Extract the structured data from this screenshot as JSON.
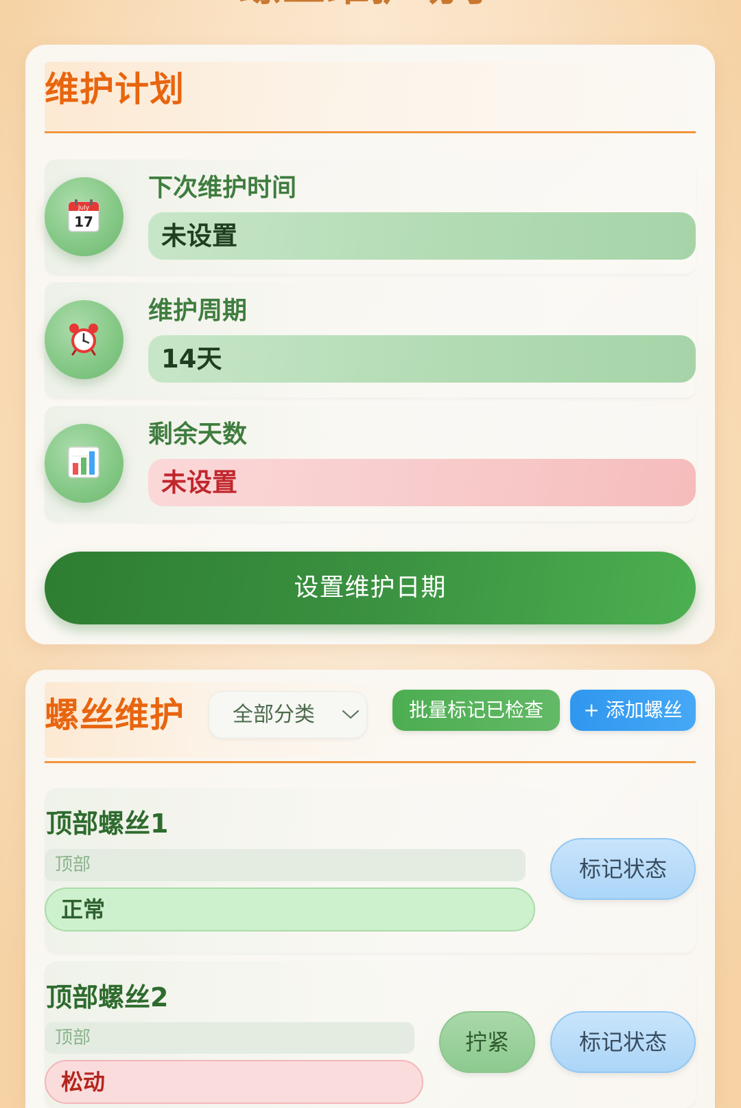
{
  "app": {
    "title": "螺丝维护助手"
  },
  "colors": {
    "accent_orange": "#e8650f",
    "primary_green": "#2e7d32",
    "add_blue": "#2f97ef",
    "warning_red": "#c0272d"
  },
  "plan": {
    "title": "维护计划",
    "rows": [
      {
        "icon": "calendar-icon",
        "icon_month": "July",
        "icon_day": "17",
        "label": "下次维护时间",
        "value": "未设置",
        "status": "neutral"
      },
      {
        "icon": "alarm-clock-icon",
        "label": "维护周期",
        "value": "14天",
        "status": "neutral"
      },
      {
        "icon": "bar-chart-icon",
        "label": "剩余天数",
        "value": "未设置",
        "status": "warning"
      }
    ],
    "set_date_button": "设置维护日期"
  },
  "screws": {
    "title": "螺丝维护",
    "filter": {
      "selected": "全部分类",
      "icon": "chevron-down-icon"
    },
    "batch_button": "批量标记已检查",
    "add_button": "+ 添加螺丝",
    "items": [
      {
        "name": "顶部螺丝1",
        "category": "顶部",
        "status": "正常",
        "mark_button": "标记状态"
      },
      {
        "name": "顶部螺丝2",
        "category": "顶部",
        "status": "松动",
        "tighten_button": "拧紧",
        "mark_button": "标记状态"
      }
    ]
  }
}
